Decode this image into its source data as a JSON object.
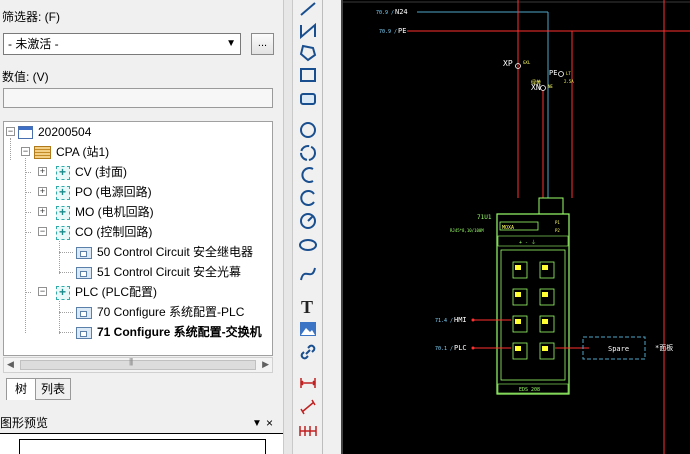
{
  "filter": {
    "label": "筛选器: (F)",
    "selected": "- 未激活 -",
    "more_label": "..."
  },
  "value": {
    "label": "数值: (V)",
    "input": ""
  },
  "tree": {
    "root": "20200504",
    "station": "CPA (站1)",
    "functions": [
      {
        "label": "CV (封面)"
      },
      {
        "label": "PO (电源回路)"
      },
      {
        "label": "MO (电机回路)"
      },
      {
        "label": "CO (控制回路)"
      }
    ],
    "co_pages": [
      {
        "label": "50 Control Circuit 安全继电器"
      },
      {
        "label": "51 Control Circuit 安全光幕"
      }
    ],
    "plc": {
      "label": "PLC (PLC配置)"
    },
    "plc_pages": [
      {
        "label": "70 Configure 系统配置-PLC"
      },
      {
        "label": "71 Configure 系统配置-交换机"
      }
    ]
  },
  "tabs": {
    "tree": "树",
    "list": "列表"
  },
  "preview": {
    "title": "图形预览",
    "pin": "▼",
    "close": "×"
  },
  "toolbar_icons": [
    "line-icon",
    "polyline-icon",
    "polygon-icon",
    "rectangle-icon",
    "rounded-rect-icon",
    "circle-icon",
    "circle-3point-icon",
    "arc-icon",
    "arc-3point-icon",
    "sector-icon",
    "ellipse-icon",
    "spline-icon",
    "text-icon",
    "image-icon",
    "hyperlink-icon",
    "dimension-icon",
    "dimension-aligned-icon",
    "dimension-chain-icon"
  ],
  "schematic": {
    "n24_ref": "70.9 /",
    "n24": "N24",
    "pe_ref": "70.9 /",
    "pe": "PE",
    "xp": "XP",
    "xp_pin": "GXL",
    "pe_term": "PE",
    "pe_pin": "LT",
    "pe_cs": "2.5A",
    "xn": "XN",
    "xn_pin": "NE",
    "xn_note": "绿黄",
    "device_tag": "71U1",
    "device_type": "MOXA",
    "device_spec": "RJ45*8,10/100M",
    "device_footer": "EDS 208",
    "p1": "P1",
    "p2": "P2",
    "pins": "+  -  ⏚",
    "hmi_ref": "71.4 /",
    "hmi": "HMI",
    "plc_ref": "70.1 /",
    "plc": "PLC",
    "spare": "Spare",
    "panel": "*面板"
  }
}
